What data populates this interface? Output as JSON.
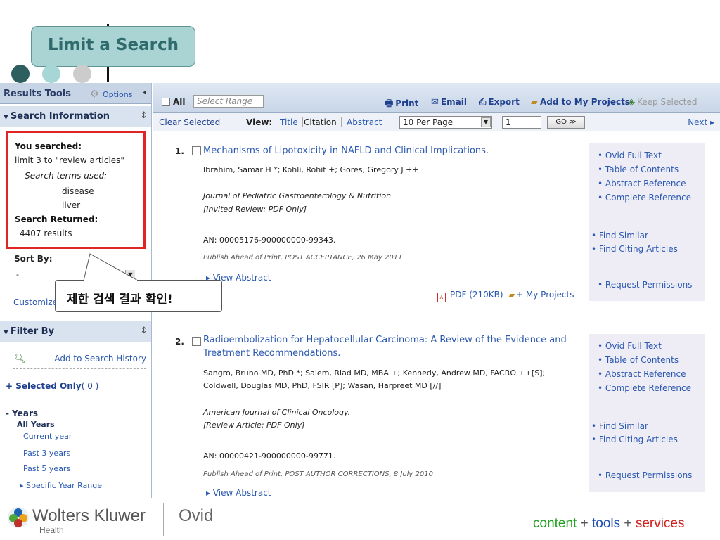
{
  "slide": {
    "title": "Limit a Search"
  },
  "callout": {
    "text": "제한 검색 결과 확인!"
  },
  "left": {
    "results_tools": "Results Tools",
    "options": "Options",
    "search_information": "Search Information",
    "you_searched_label": "You searched:",
    "query": "limit 3 to \"review articles\"",
    "terms_label": "- Search terms used:",
    "terms": [
      "disease",
      "liver"
    ],
    "returned_label": "Search Returned:",
    "returned_value": "4407 results",
    "sort_by": "Sort By:",
    "sort_value": "-",
    "customize": "Customize",
    "filter_by": "Filter By",
    "add_history": "Add to Search History",
    "selected_only": "+ Selected Only",
    "selected_count": "( 0 )",
    "years": "- Years",
    "all_years": "All Years",
    "current_year": "Current year",
    "past3": "Past 3 years",
    "past5": "Past 5 years",
    "specific_range": "Specific Year Range"
  },
  "toolbar": {
    "all": "All",
    "range_placeholder": "Select Range",
    "print": "Print",
    "email": "Email",
    "export": "Export",
    "add_projects": "Add to My Projects",
    "keep_selected": "Keep Selected",
    "clear_selected": "Clear Selected",
    "view": "View:",
    "view_title": "Title",
    "view_citation": "Citation",
    "view_abstract": "Abstract",
    "per_page": "10 Per Page",
    "page": "1",
    "go": "GO ≫",
    "next": "Next ▸"
  },
  "results": [
    {
      "num": "1.",
      "title": "Mechanisms of Lipotoxicity in NAFLD and Clinical Implications.",
      "authors1": "Ibrahim, Samar H *; Kohli, Rohit +; Gores, Gregory J ++",
      "authors2": "",
      "journal": "Journal of Pediatric Gastroenterology & Nutrition.",
      "type": "[Invited Review: PDF Only]",
      "an": "AN: 00005176-900000000-99343.",
      "publish": "Publish Ahead of Print, POST ACCEPTANCE, 26 May 2011",
      "view_abstract": "▸ View Abstract",
      "pdf": "PDF (210KB)",
      "projects": "+ My Projects"
    },
    {
      "num": "2.",
      "title": "Radioembolization for Hepatocellular Carcinoma: A Review of the Evidence and Treatment Recommendations.",
      "authors1": "Sangro, Bruno MD, PhD *; Salem, Riad MD, MBA +; Kennedy, Andrew MD, FACRO ++[S];",
      "authors2": "Coldwell, Douglas MD, PhD, FSIR [P]; Wasan, Harpreet MD [//]",
      "journal": "American Journal of Clinical Oncology.",
      "type": "[Review Article: PDF Only]",
      "an": "AN: 00000421-900000000-99771.",
      "publish": "Publish Ahead of Print, POST AUTHOR CORRECTIONS, 8 July 2010",
      "view_abstract": "▸ View Abstract",
      "pdf": "",
      "projects": ""
    }
  ],
  "side": {
    "ovid_full_text": "• Ovid Full Text",
    "toc": "• Table of Contents",
    "abstract_ref": "• Abstract Reference",
    "complete_ref": "• Complete Reference",
    "find_similar": "• Find Similar",
    "find_citing": "• Find Citing Articles",
    "permissions": "• Request Permissions"
  },
  "footer": {
    "brand": "Wolters Kluwer",
    "brand_sub": "Health",
    "ovid": "Ovid",
    "tag_content": "content",
    "tag_plus": "+",
    "tag_tools": "tools",
    "tag_services": "services"
  },
  "colors": {
    "accent_teal": "#aad4d4",
    "highlight_red": "#e02525",
    "link_blue": "#2a58b0"
  }
}
